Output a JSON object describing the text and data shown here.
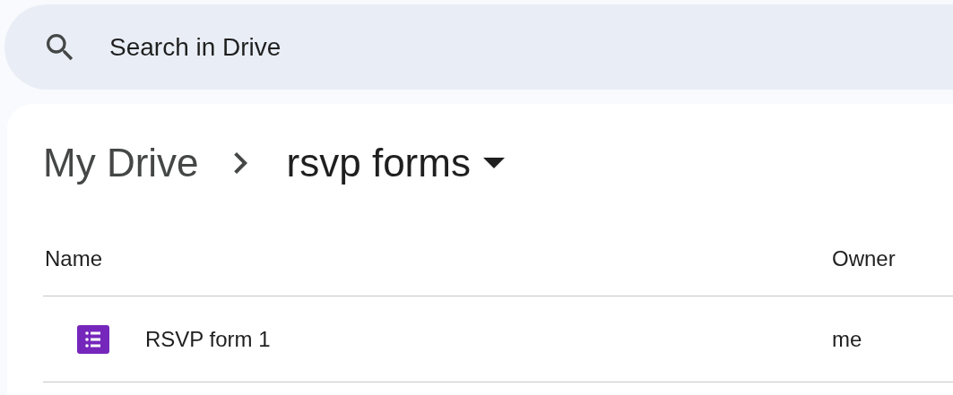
{
  "search": {
    "placeholder": "Search in Drive"
  },
  "breadcrumb": [
    {
      "label": "My Drive",
      "current": false
    },
    {
      "label": "rsvp forms",
      "current": true
    }
  ],
  "table": {
    "columns": [
      "Name",
      "Owner"
    ],
    "rows": [
      {
        "kind": "form",
        "name": "RSVP form 1",
        "owner": "me"
      }
    ]
  }
}
